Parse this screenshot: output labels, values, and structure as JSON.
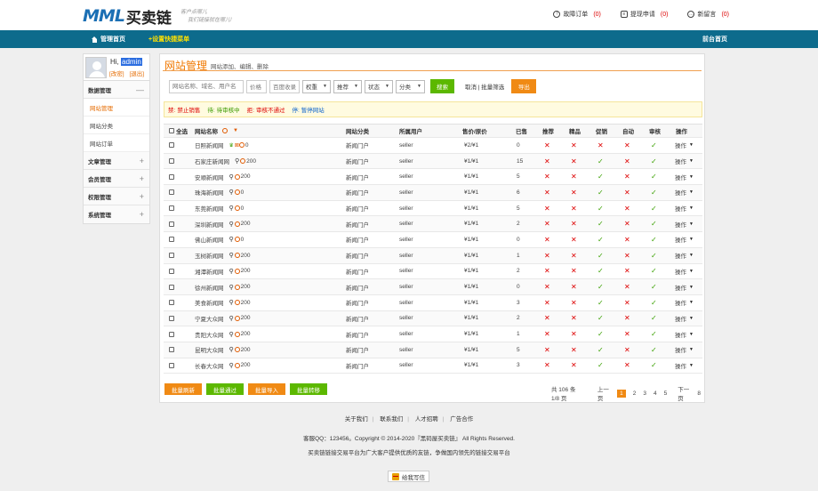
{
  "header": {
    "logo_mark": "MML",
    "logo_text": "买卖链",
    "slogan_line1": "客户点哪儿",
    "slogan_line2": "我们链接就在哪儿!",
    "links": [
      {
        "label": "故障订单",
        "count": "(0)",
        "icon": "fault-icon"
      },
      {
        "label": "提现申请",
        "count": "(0)",
        "icon": "withdraw-icon"
      },
      {
        "label": "新留言",
        "count": "(0)",
        "icon": "message-icon"
      }
    ]
  },
  "nav": {
    "home": "管理首页",
    "quick_menu": "+设置快捷菜单",
    "front_home": "前台首页"
  },
  "sidebar": {
    "greeting": "Hi,",
    "username": "admin",
    "modify": "[改密]",
    "logout": "[退出]",
    "groups": [
      {
        "label": "数据管理",
        "toggle": "—",
        "items": [
          "网站管理",
          "网站分类",
          "网站订单"
        ]
      },
      {
        "label": "文章管理",
        "toggle": "+"
      },
      {
        "label": "会员管理",
        "toggle": "+"
      },
      {
        "label": "权限管理",
        "toggle": "+"
      },
      {
        "label": "系统管理",
        "toggle": "+"
      }
    ]
  },
  "main": {
    "title": "网站管理",
    "subtitle": "网站添加、编辑、删除",
    "filters": {
      "search_placeholder": "网站名称、域名、用户名",
      "price": "价格",
      "baidu": "百度收录",
      "weight": "权重",
      "recommend": "推荐",
      "status": "状态",
      "category": "分类",
      "search_btn": "搜索",
      "cancel_text": "取消 | 批量筛选",
      "export_btn": "导出"
    },
    "legend": [
      {
        "key": "禁:",
        "text": "禁止销售",
        "color": "red"
      },
      {
        "key": "待:",
        "text": "待审核中",
        "color": "green"
      },
      {
        "key": "拒:",
        "text": "审核不通过",
        "color": "red"
      },
      {
        "key": "停:",
        "text": "暂停网站",
        "color": "blue"
      }
    ],
    "table": {
      "headers": {
        "select_all": "全选",
        "name": "网站名称",
        "category": "网站分类",
        "owner": "所属用户",
        "price": "售价/原价",
        "sold": "已售",
        "recommend": "推荐",
        "boutique": "精品",
        "promo": "促销",
        "auto": "自动",
        "audit": "审核",
        "action": "操作"
      },
      "rows": [
        {
          "name": "日照新闻网",
          "hot": true,
          "count": "0",
          "category": "新闻门户",
          "owner": "seller",
          "price": "¥2/¥1",
          "sold": "0",
          "flags": [
            "x",
            "x",
            "x",
            "x",
            "v"
          ],
          "action": "操作"
        },
        {
          "name": "石家庄新闻网",
          "hot": false,
          "count": "200",
          "category": "新闻门户",
          "owner": "seller",
          "price": "¥1/¥1",
          "sold": "15",
          "flags": [
            "x",
            "x",
            "v",
            "x",
            "v"
          ],
          "action": "操作"
        },
        {
          "name": "安顺新闻网",
          "hot": false,
          "count": "200",
          "category": "新闻门户",
          "owner": "seller",
          "price": "¥1/¥1",
          "sold": "5",
          "flags": [
            "x",
            "x",
            "v",
            "x",
            "v"
          ],
          "action": "操作"
        },
        {
          "name": "珠海新闻网",
          "hot": false,
          "count": "0",
          "category": "新闻门户",
          "owner": "seller",
          "price": "¥1/¥1",
          "sold": "6",
          "flags": [
            "x",
            "x",
            "v",
            "x",
            "v"
          ],
          "action": "操作"
        },
        {
          "name": "东莞新闻网",
          "hot": false,
          "count": "0",
          "category": "新闻门户",
          "owner": "seller",
          "price": "¥1/¥1",
          "sold": "5",
          "flags": [
            "x",
            "x",
            "v",
            "x",
            "v"
          ],
          "action": "操作"
        },
        {
          "name": "深圳新闻网",
          "hot": false,
          "count": "200",
          "category": "新闻门户",
          "owner": "seller",
          "price": "¥1/¥1",
          "sold": "2",
          "flags": [
            "x",
            "x",
            "v",
            "x",
            "v"
          ],
          "action": "操作"
        },
        {
          "name": "佛山新闻网",
          "hot": false,
          "count": "0",
          "category": "新闻门户",
          "owner": "seller",
          "price": "¥1/¥1",
          "sold": "0",
          "flags": [
            "x",
            "x",
            "v",
            "x",
            "v"
          ],
          "action": "操作"
        },
        {
          "name": "玉树新闻网",
          "hot": false,
          "count": "200",
          "category": "新闻门户",
          "owner": "seller",
          "price": "¥1/¥1",
          "sold": "1",
          "flags": [
            "x",
            "x",
            "v",
            "x",
            "v"
          ],
          "action": "操作"
        },
        {
          "name": "湘潭新闻网",
          "hot": false,
          "count": "200",
          "category": "新闻门户",
          "owner": "seller",
          "price": "¥1/¥1",
          "sold": "2",
          "flags": [
            "x",
            "x",
            "v",
            "x",
            "v"
          ],
          "action": "操作"
        },
        {
          "name": "徐州新闻网",
          "hot": false,
          "count": "200",
          "category": "新闻门户",
          "owner": "seller",
          "price": "¥1/¥1",
          "sold": "0",
          "flags": [
            "x",
            "x",
            "v",
            "x",
            "v"
          ],
          "action": "操作"
        },
        {
          "name": "美食新闻网",
          "hot": false,
          "count": "200",
          "category": "新闻门户",
          "owner": "seller",
          "price": "¥1/¥1",
          "sold": "3",
          "flags": [
            "x",
            "x",
            "v",
            "x",
            "v"
          ],
          "action": "操作"
        },
        {
          "name": "宁夏大众网",
          "hot": false,
          "count": "200",
          "category": "新闻门户",
          "owner": "seller",
          "price": "¥1/¥1",
          "sold": "2",
          "flags": [
            "x",
            "x",
            "v",
            "x",
            "v"
          ],
          "action": "操作"
        },
        {
          "name": "贵阳大众网",
          "hot": false,
          "count": "200",
          "category": "新闻门户",
          "owner": "seller",
          "price": "¥1/¥1",
          "sold": "1",
          "flags": [
            "x",
            "x",
            "v",
            "x",
            "v"
          ],
          "action": "操作"
        },
        {
          "name": "昆明大众网",
          "hot": false,
          "count": "200",
          "category": "新闻门户",
          "owner": "seller",
          "price": "¥1/¥1",
          "sold": "5",
          "flags": [
            "x",
            "x",
            "v",
            "x",
            "v"
          ],
          "action": "操作"
        },
        {
          "name": "长春大众网",
          "hot": false,
          "count": "200",
          "category": "新闻门户",
          "owner": "seller",
          "price": "¥1/¥1",
          "sold": "3",
          "flags": [
            "x",
            "x",
            "v",
            "x",
            "v"
          ],
          "action": "操作"
        }
      ]
    },
    "bottom_buttons": [
      {
        "label": "批量刷新",
        "color": "#f08a14"
      },
      {
        "label": "批量通过",
        "color": "#5cb800"
      },
      {
        "label": "批量导入",
        "color": "#f08a14"
      },
      {
        "label": "批量转移",
        "color": "#5cb800"
      }
    ],
    "pager": {
      "info": "共 106 条 1/8 页",
      "prev": "上一页",
      "pages": [
        "1",
        "2",
        "3",
        "4",
        "5"
      ],
      "current": "1",
      "next": "下一页",
      "last": "8"
    }
  },
  "footer": {
    "links": [
      "关于我们",
      "联系我们",
      "人才招聘",
      "广告合作"
    ],
    "copyright": "客服QQ：123456。Copyright © 2014-2020『黑码屋买卖链』 All Rights Reserved.",
    "desc": "买卖链链接交易平台为广大客户提供优质的友链，争做国内领先的链接交易平台",
    "feedback": "给我写信"
  },
  "colors": {
    "nav_bg": "#0d6b8c",
    "accent_orange": "#f08a14",
    "accent_green": "#5cb800",
    "title_orange": "#f07800"
  }
}
